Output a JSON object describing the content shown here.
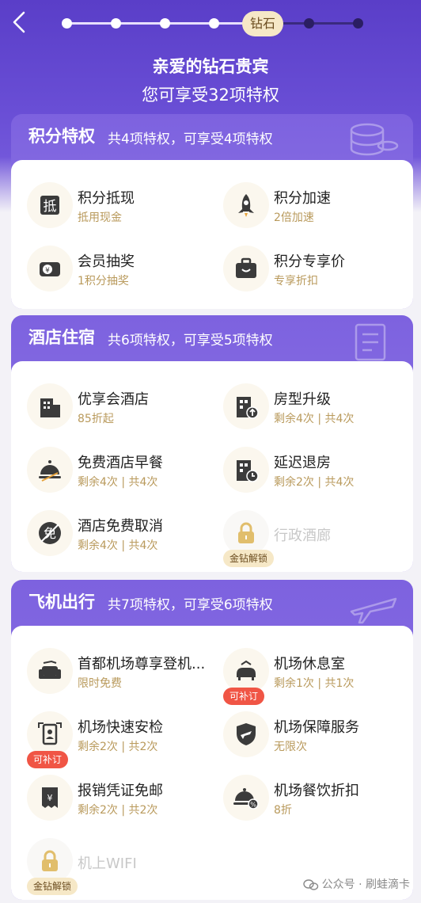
{
  "header": {
    "back_icon": "chevron-left-icon",
    "current_level": "钻石",
    "progress": {
      "total_levels": 7,
      "current_index": 5
    },
    "greeting": "亲爱的钻石贵宾",
    "summary": "您可享受32项特权"
  },
  "colors": {
    "primary": "#6a4fd6",
    "gold_text": "#b99a5c",
    "pill_bg": "#f6e8c7",
    "red_tag": "#f05545"
  },
  "sections": [
    {
      "title": "积分特权",
      "subtitle": "共4项特权，可享受4项特权",
      "deco_icon": "coins-icon",
      "items": [
        {
          "name": "积分抵现",
          "sub": "抵用现金",
          "icon": "deduct-icon"
        },
        {
          "name": "积分加速",
          "sub": "2倍加速",
          "icon": "rocket-icon"
        },
        {
          "name": "会员抽奖",
          "sub": "1积分抽奖",
          "icon": "lottery-icon"
        },
        {
          "name": "积分专享价",
          "sub": "专享折扣",
          "icon": "suitcase-icon"
        }
      ]
    },
    {
      "title": "酒店住宿",
      "subtitle": "共6项特权，可享受5项特权",
      "deco_icon": "document-icon",
      "items": [
        {
          "name": "优享会酒店",
          "sub": "85折起",
          "icon": "hotel-icon"
        },
        {
          "name": "房型升级",
          "sub": "剩余4次 | 共4次",
          "icon": "hotel-upgrade-icon"
        },
        {
          "name": "免费酒店早餐",
          "sub": "剩余4次 | 共4次",
          "icon": "cloche-icon"
        },
        {
          "name": "延迟退房",
          "sub": "剩余2次 | 共4次",
          "icon": "hotel-clock-icon"
        },
        {
          "name": "酒店免费取消",
          "sub": "剩余4次 | 共4次",
          "icon": "free-cancel-icon"
        },
        {
          "name": "行政酒廊",
          "sub": "",
          "icon": "lock-icon",
          "tag": "金钻解锁"
        }
      ]
    },
    {
      "title": "飞机出行",
      "subtitle": "共7项特权，可享受6项特权",
      "deco_icon": "airplane-icon",
      "items": [
        {
          "name": "首都机场尊享登机...",
          "sub": "限时免费",
          "icon": "sofa-icon"
        },
        {
          "name": "机场休息室",
          "sub": "剩余1次 | 共1次",
          "icon": "lounge-icon",
          "tag": "可补订"
        },
        {
          "name": "机场快速安检",
          "sub": "剩余2次 | 共2次",
          "icon": "security-check-icon",
          "tag": "可补订"
        },
        {
          "name": "机场保障服务",
          "sub": "无限次",
          "icon": "shield-plane-icon"
        },
        {
          "name": "报销凭证免邮",
          "sub": "剩余2次 | 共2次",
          "icon": "receipt-icon"
        },
        {
          "name": "机场餐饮折扣",
          "sub": "8折",
          "icon": "dining-discount-icon"
        },
        {
          "name": "机上WIFI",
          "sub": "",
          "icon": "lock-icon",
          "tag": "金钻解锁"
        }
      ]
    }
  ],
  "watermark": "公众号 · 刷蛙滴卡"
}
